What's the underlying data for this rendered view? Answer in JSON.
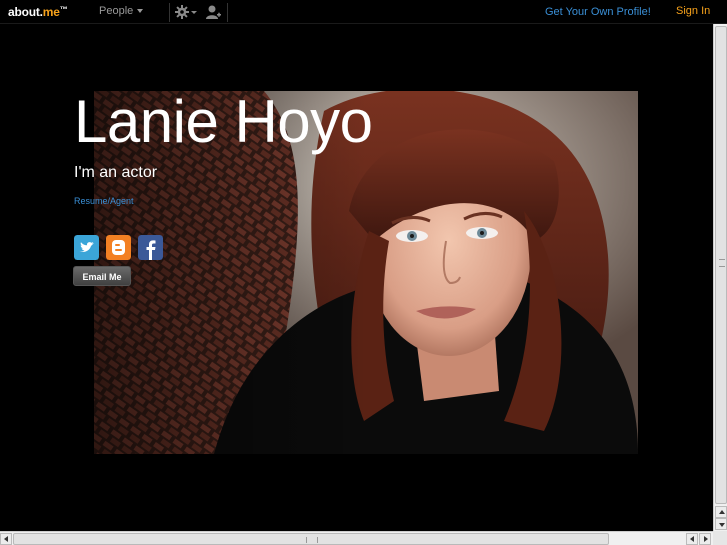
{
  "topbar": {
    "logo_main": "about.",
    "logo_accent": "me",
    "logo_tm": "™",
    "people_label": "People",
    "get_profile_label": "Get Your Own Profile!",
    "sign_in_label": "Sign In"
  },
  "profile": {
    "name": "Lanie Hoyo",
    "headline": "I'm an actor",
    "link_label": "Resume/Agent",
    "email_button_label": "Email Me",
    "social_icons": [
      "twitter-icon",
      "blogger-icon",
      "facebook-icon"
    ]
  },
  "colors": {
    "accent_orange": "#f7a21b",
    "link_blue": "#3a8fd6",
    "background": "#000000",
    "twitter": "#3ba5d8",
    "blogger": "#f38023",
    "facebook": "#3b5998"
  }
}
